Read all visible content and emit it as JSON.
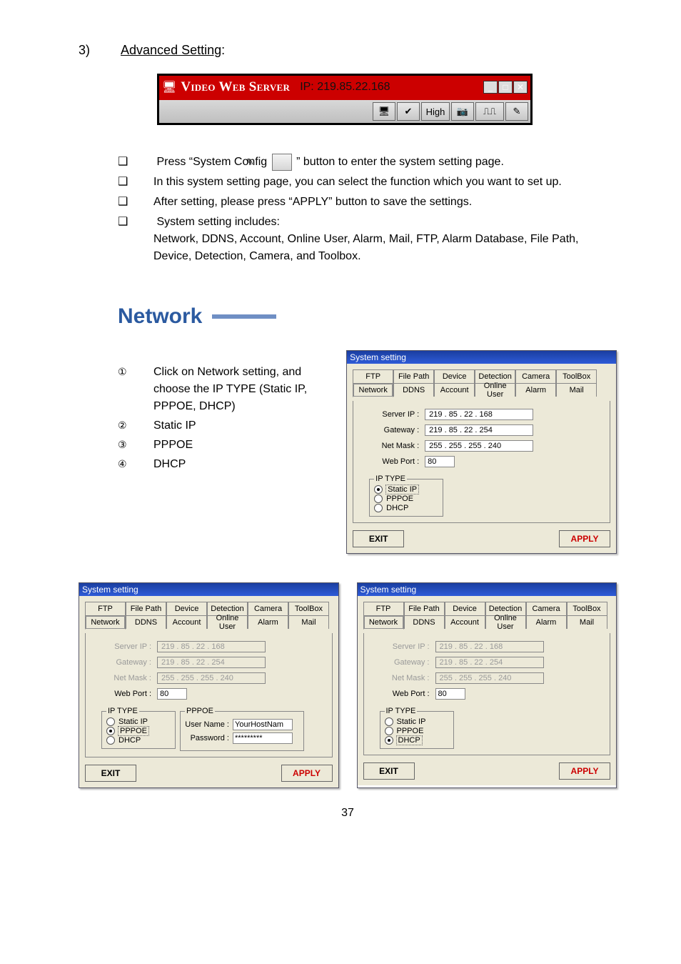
{
  "section": {
    "number": "3)",
    "title": "Advanced Setting",
    "after": ":"
  },
  "vws_bar": {
    "app_name": "Video Web Server",
    "ip_label": "IP:",
    "ip": "219.85.22.168",
    "toolbar_icons": [
      "monitor-icon",
      "check-icon",
      "high-button",
      "camera-icon",
      "sliders-icon",
      "config-icon"
    ],
    "high_label": "High"
  },
  "bullets": {
    "b1a": "Press “System Config ",
    "b1b": " ” button to enter the system setting page.",
    "b2": "In this system setting page, you can select the function which you want to set up.",
    "b3": "After setting, please press “APPLY” button to save the settings.",
    "b4a": "System setting includes:",
    "b4b": "Network, DDNS, Account, Online User, Alarm, Mail, FTP, Alarm Database, File Path, Device, Detection, Camera, and Toolbox."
  },
  "network_heading": "Network",
  "enum": {
    "m1": "①",
    "t1": "Click on Network setting, and choose the IP TYPE (Static IP, PPPOE, DHCP)",
    "m2": "②",
    "t2": "Static IP",
    "m3": "③",
    "t3": "PPPOE",
    "m4": "④",
    "t4": "DHCP"
  },
  "panel_common": {
    "title": "System setting",
    "tabs_row1": [
      "FTP",
      "File Path",
      "Device",
      "Detection",
      "Camera",
      "ToolBox"
    ],
    "tabs_row2": [
      "Network",
      "DDNS",
      "Account",
      "Online User",
      "Alarm",
      "Mail"
    ],
    "labels": {
      "server_ip": "Server IP :",
      "gateway": "Gateway :",
      "netmask": "Net Mask :",
      "webport": "Web Port :",
      "iptype_legend": "IP TYPE",
      "pppoe_legend": "PPPOE",
      "username": "User Name :",
      "password": "Password :"
    },
    "ip_options": [
      "Static IP",
      "PPPOE",
      "DHCP"
    ],
    "buttons": {
      "exit": "EXIT",
      "apply": "APPLY"
    }
  },
  "panelA": {
    "selected_tab": "Network",
    "server_ip": "219  .   85  .   22   .  168",
    "gateway": "219  .   85  .   22   .  254",
    "netmask": "255  .  255  .  255  .  240",
    "webport": "80",
    "ip_type_selected": "Static IP",
    "fields_disabled": false
  },
  "panelB": {
    "selected_tab": "Network",
    "server_ip": "219  .   85  .   22   .  168",
    "gateway": "219  .   85  .   22   .  254",
    "netmask": "255  .  255  .  255  .  240",
    "webport": "80",
    "ip_type_selected": "PPPOE",
    "fields_disabled": true,
    "pppoe_user": "YourHostNam",
    "pppoe_pass": "*********"
  },
  "panelC": {
    "selected_tab": "Network",
    "server_ip": "219  .   85  .   22   .  168",
    "gateway": "219  .   85  .   22   .  254",
    "netmask": "255  .  255  .  255  .  240",
    "webport": "80",
    "ip_type_selected": "DHCP",
    "fields_disabled": true
  },
  "page_number": "37"
}
